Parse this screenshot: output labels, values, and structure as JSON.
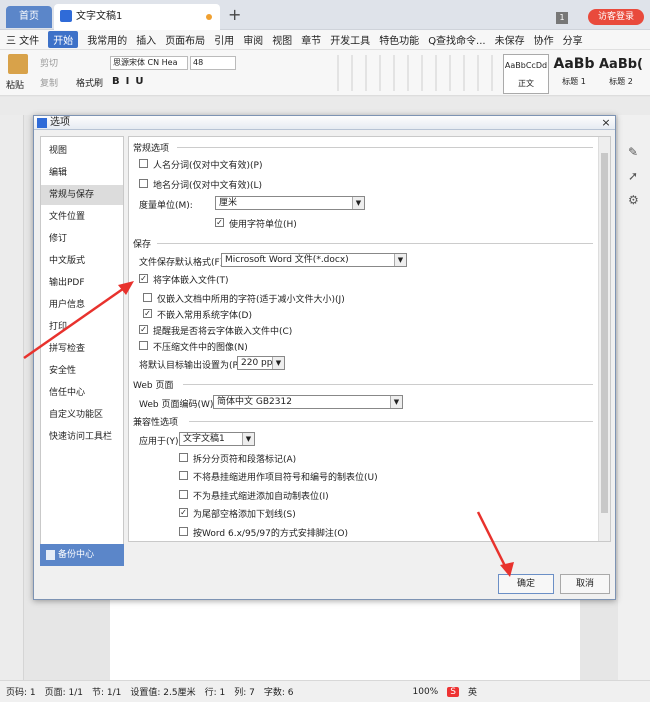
{
  "tabs": {
    "home": "首页",
    "doc": "文字文稿1"
  },
  "topright": {
    "badge": "1",
    "visitor": "访客登录"
  },
  "menu": {
    "items": [
      "三 文件",
      "开始",
      "我常用的",
      "插入",
      "页面布局",
      "引用",
      "审阅",
      "视图",
      "章节",
      "开发工具",
      "特色功能",
      "Q查找命令...",
      "未保存",
      "协作",
      "分享"
    ]
  },
  "ribbon": {
    "paste": "粘贴",
    "cut": "剪切",
    "copy": "复制",
    "format_painter": "格式刷",
    "font_name": "思源宋体 CN Hea",
    "font_size": "48",
    "styles": [
      {
        "preview": "AaBbCcDd",
        "name": "正文"
      },
      {
        "preview": "AaBb",
        "name": "标题 1"
      },
      {
        "preview": "AaBb(",
        "name": "标题 2"
      }
    ]
  },
  "dialog": {
    "title": "选项",
    "close": "×",
    "nav": [
      "视图",
      "编辑",
      "常规与保存",
      "文件位置",
      "修订",
      "中文版式",
      "输出PDF",
      "用户信息",
      "打印",
      "拼写检查",
      "安全性",
      "信任中心",
      "自定义功能区",
      "快速访问工具栏"
    ],
    "nav_selected": 2,
    "backup": "备份中心",
    "general": {
      "header": "常规选项",
      "name_split": "人名分词(仅对中文有效)(P)",
      "place_split": "地名分词(仅对中文有效)(L)",
      "unit_label": "度量单位(M):",
      "unit_value": "厘米",
      "char_unit": "使用字符单位(H)"
    },
    "save": {
      "header": "保存",
      "format_label": "文件保存默认格式(F):",
      "format_value": "Microsoft Word 文件(*.docx)",
      "embed_fonts": "将字体嵌入文件(T)",
      "embed_used_only": "仅嵌入文档中所用的字符(适于减小文件大小)(J)",
      "no_common": "不嵌入常用系统字体(D)",
      "remind_cloud": "提醒我是否将云字体嵌入文件中(C)",
      "no_compress": "不压缩文件中的图像(N)",
      "target_label": "将默认目标输出设置为(P):",
      "target_value": "220 ppi"
    },
    "web": {
      "header": "Web 页面",
      "encoding_label": "Web 页面编码(W):",
      "encoding_value": "简体中文 GB2312"
    },
    "compat": {
      "header": "兼容性选项",
      "apply_label": "应用于(Y):",
      "apply_value": "文字文稿1",
      "opts": [
        {
          "label": "拆分分页符和段落标记(A)",
          "checked": false
        },
        {
          "label": "不将悬挂缩进用作项目符号和编号的制表位(U)",
          "checked": false
        },
        {
          "label": "不为悬挂式缩进添加自动制表位(I)",
          "checked": false
        },
        {
          "label": "为尾部空格添加下划线(S)",
          "checked": true
        },
        {
          "label": "按Word 6.x/95/97的方式安排脚注(O)",
          "checked": false
        }
      ]
    },
    "ok": "确定",
    "cancel": "取消"
  },
  "status": {
    "items": [
      "页码: 1",
      "页面: 1/1",
      "节: 1/1",
      "设置值: 2.5厘米",
      "行: 1",
      "列: 7",
      "字数: 6"
    ],
    "zoom": "100%",
    "ime": "英"
  }
}
